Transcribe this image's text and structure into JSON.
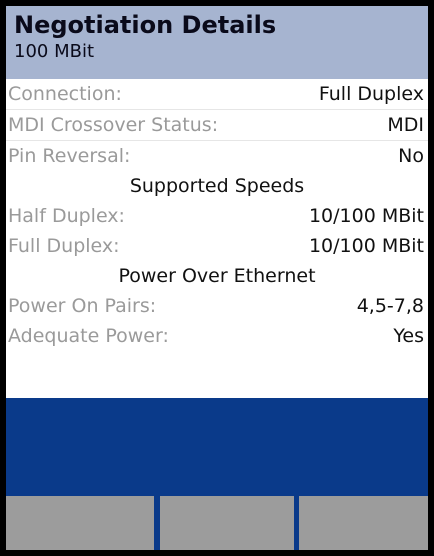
{
  "header": {
    "title": "Negotiation Details",
    "subtitle": "100 MBit"
  },
  "details": {
    "connection": {
      "label": "Connection:",
      "value": "Full Duplex"
    },
    "mdi": {
      "label": "MDI Crossover Status:",
      "value": "MDI"
    },
    "pin_reversal": {
      "label": "Pin Reversal:",
      "value": "No"
    }
  },
  "speeds": {
    "heading": "Supported Speeds",
    "half_duplex": {
      "label": "Half Duplex:",
      "value": "10/100 MBit"
    },
    "full_duplex": {
      "label": "Full Duplex:",
      "value": "10/100 MBit"
    }
  },
  "poe": {
    "heading": "Power Over Ethernet",
    "pairs": {
      "label": "Power On Pairs:",
      "value": "4,5-7,8"
    },
    "adequate": {
      "label": "Adequate Power:",
      "value": "Yes"
    }
  },
  "colors": {
    "header_bg": "#a6b4d0",
    "band_bg": "#0a3a8a",
    "softkey_bg": "#9c9c9c",
    "label_color": "#9a9a9a"
  }
}
